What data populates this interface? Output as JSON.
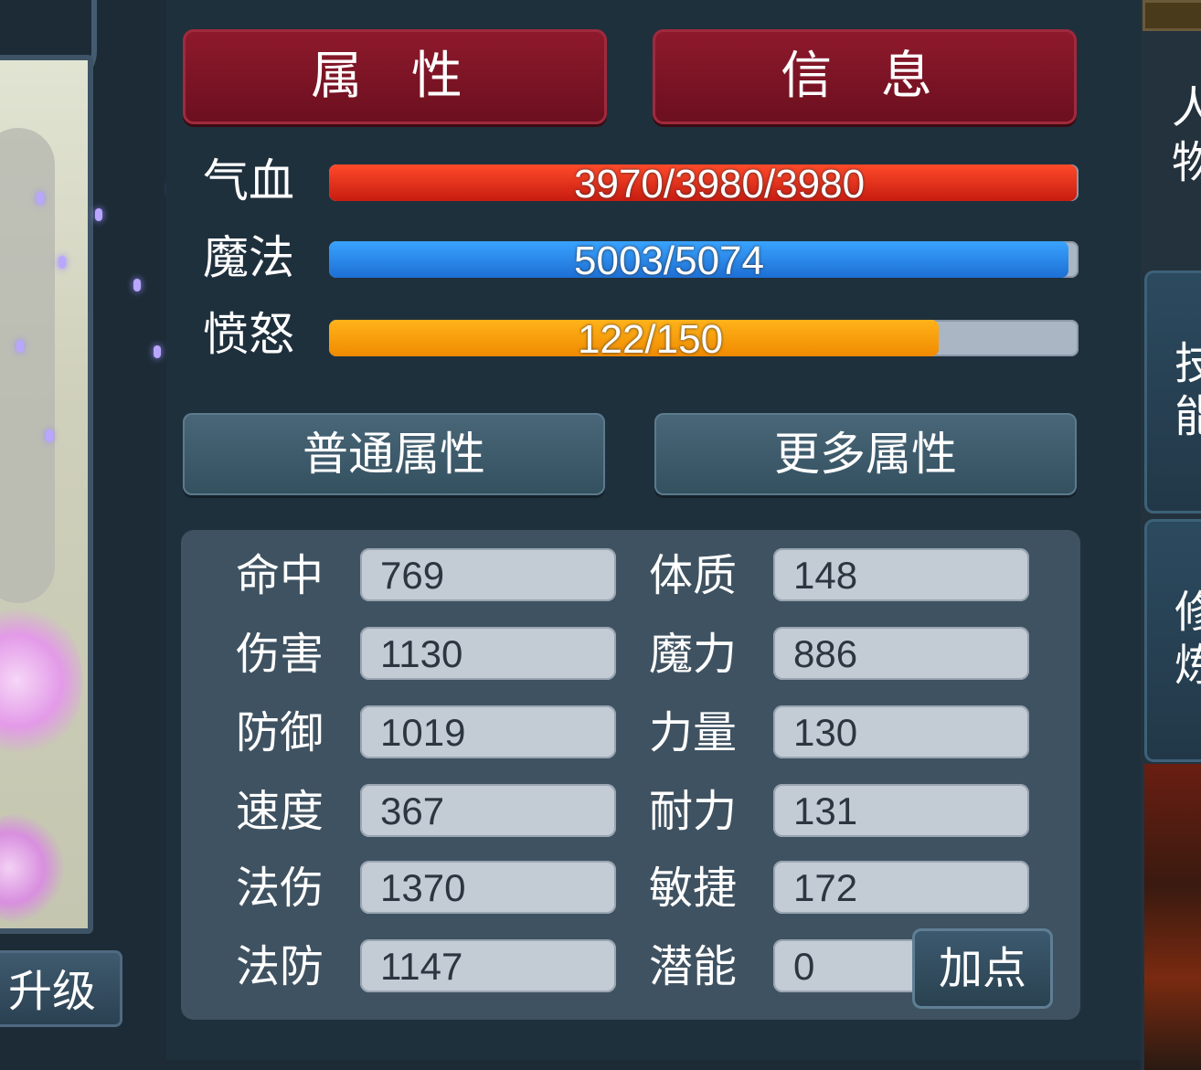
{
  "tabs": {
    "attributes": "属 性",
    "info": "信 息"
  },
  "stats": {
    "hp": {
      "label": "气血",
      "text": "3970/3980/3980",
      "fill": 0.997
    },
    "mp": {
      "label": "魔法",
      "text": "5003/5074",
      "fill": 0.986
    },
    "rage": {
      "label": "愤怒",
      "text": "122/150",
      "fill": 0.813
    }
  },
  "subtabs": {
    "basic": "普通属性",
    "more": "更多属性"
  },
  "attributes_left": [
    {
      "label": "命中",
      "value": "769"
    },
    {
      "label": "伤害",
      "value": "1130"
    },
    {
      "label": "防御",
      "value": "1019"
    },
    {
      "label": "速度",
      "value": "367"
    },
    {
      "label": "法伤",
      "value": "1370"
    },
    {
      "label": "法防",
      "value": "1147"
    }
  ],
  "attributes_right": [
    {
      "label": "体质",
      "value": "148"
    },
    {
      "label": "魔力",
      "value": "886"
    },
    {
      "label": "力量",
      "value": "130"
    },
    {
      "label": "耐力",
      "value": "131"
    },
    {
      "label": "敏捷",
      "value": "172"
    },
    {
      "label": "潜能",
      "value": "0"
    }
  ],
  "add_point_button": "加点",
  "upgrade_button": "升级",
  "side": {
    "top_label": "人物",
    "tab_skills": "技能",
    "tab_cultivation": "修炼"
  },
  "colors": {
    "hp": "#e0311c",
    "mp": "#2d8cf0",
    "rage": "#f79c0b",
    "tab_red": "#7d1526",
    "panel": "#1f303d"
  }
}
